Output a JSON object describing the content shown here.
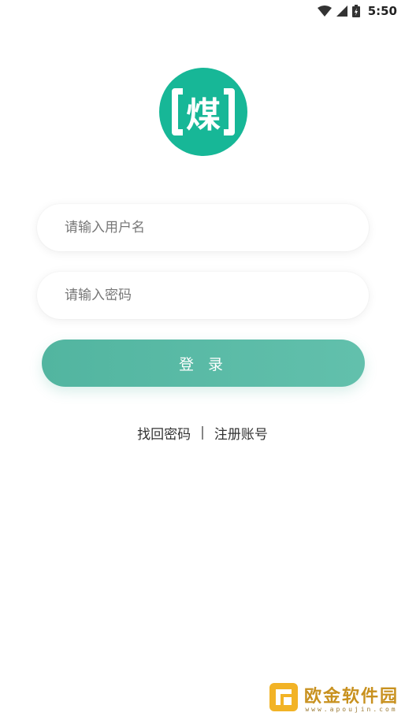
{
  "status_bar": {
    "time": "5:50",
    "icons": [
      "wifi-icon",
      "signal-icon",
      "battery-icon"
    ]
  },
  "logo": {
    "character": "煤",
    "background_color": "#17b797"
  },
  "form": {
    "username_placeholder": "请输入用户名",
    "username_value": "",
    "password_placeholder": "请输入密码",
    "password_value": "",
    "login_label": "登 录",
    "button_color": "#52b5a0"
  },
  "links": {
    "forgot_password": "找回密码",
    "separator": "|",
    "register": "注册账号"
  },
  "watermark": {
    "text": "欧金软件园",
    "url": "www.apoujin.com"
  }
}
